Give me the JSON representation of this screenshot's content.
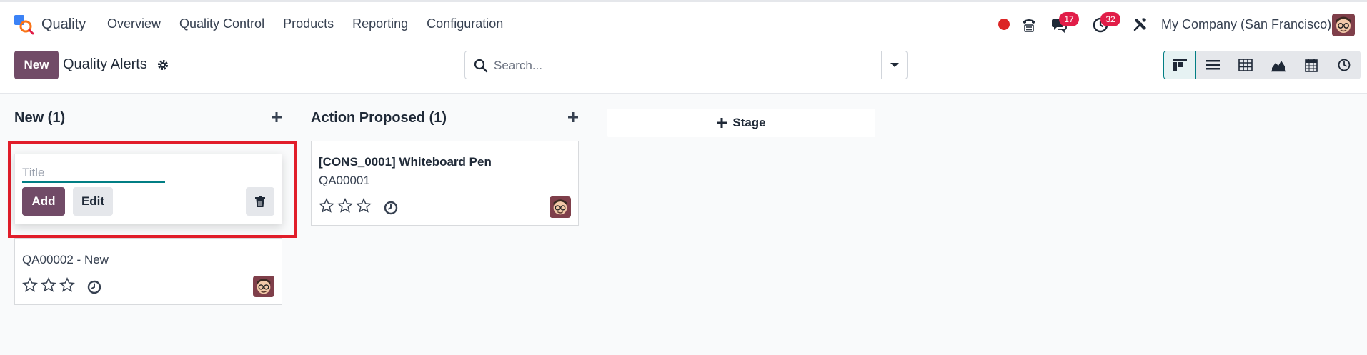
{
  "navbar": {
    "app_name": "Quality",
    "menu": [
      "Overview",
      "Quality Control",
      "Products",
      "Reporting",
      "Configuration"
    ],
    "chat_badge": "17",
    "activity_badge": "32",
    "company": "My Company (San Francisco)"
  },
  "control_panel": {
    "new_label": "New",
    "title": "Quality Alerts",
    "search_placeholder": "Search...",
    "views": [
      "kanban",
      "list",
      "pivot",
      "graph",
      "calendar",
      "activity"
    ],
    "active_view": "kanban"
  },
  "kanban": {
    "columns": [
      {
        "header": "New (1)",
        "quick_create": {
          "title_placeholder": "Title",
          "add_label": "Add",
          "edit_label": "Edit"
        },
        "cards": [
          {
            "ref": "QA00002 - New",
            "rating": 0
          }
        ]
      },
      {
        "header": "Action Proposed (1)",
        "cards": [
          {
            "title": "[CONS_0001] Whiteboard Pen",
            "ref": "QA00001",
            "rating": 0
          }
        ]
      }
    ],
    "add_stage_label": "Stage"
  },
  "colors": {
    "primary": "#714b67",
    "accent": "#017e84",
    "highlight": "#e11d2a",
    "badge": "#e11d48"
  }
}
